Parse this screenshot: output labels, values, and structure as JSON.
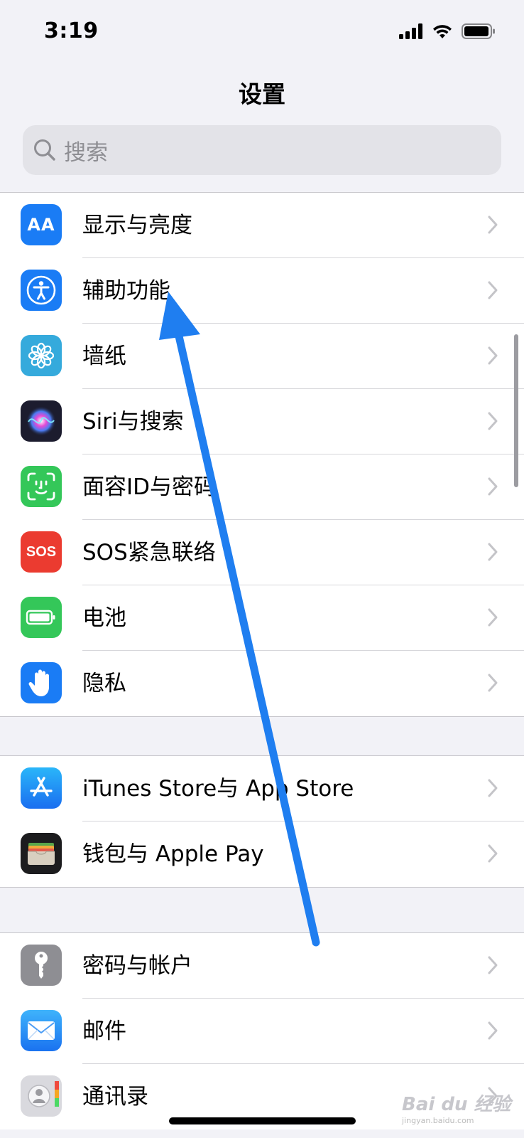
{
  "status": {
    "time": "3:19"
  },
  "nav": {
    "title": "设置"
  },
  "search": {
    "placeholder": "搜索"
  },
  "groups": [
    {
      "items": [
        {
          "label": "显示与亮度",
          "icon": "display-brightness-icon",
          "color": "#1a7cf5"
        },
        {
          "label": "辅助功能",
          "icon": "accessibility-icon",
          "color": "#1a7cf5"
        },
        {
          "label": "墙纸",
          "icon": "wallpaper-flower-icon",
          "color": "#35aadc"
        },
        {
          "label": "Siri与搜索",
          "icon": "siri-icon",
          "color": "#1c1c2e"
        },
        {
          "label": "面容ID与密码",
          "icon": "face-id-icon",
          "color": "#34c759"
        },
        {
          "label": "SOS紧急联络",
          "icon": "sos-icon",
          "color": "#eb3b30"
        },
        {
          "label": "电池",
          "icon": "battery-icon",
          "color": "#34c759"
        },
        {
          "label": "隐私",
          "icon": "privacy-hand-icon",
          "color": "#1a7cf5"
        }
      ]
    },
    {
      "items": [
        {
          "label": "iTunes Store与 App Store",
          "icon": "app-store-icon",
          "color": "#1a8cf5"
        },
        {
          "label": "钱包与 Apple Pay",
          "icon": "wallet-icon",
          "color": "#1c1c1e"
        }
      ]
    },
    {
      "items": [
        {
          "label": "密码与帐户",
          "icon": "key-icon",
          "color": "#8e8e93"
        },
        {
          "label": "邮件",
          "icon": "mail-icon",
          "color": "#2a8cf8"
        },
        {
          "label": "通讯录",
          "icon": "contacts-icon",
          "color": "#d9d9de"
        }
      ]
    }
  ],
  "icon_text": {
    "aa": "AA",
    "sos": "SOS"
  },
  "watermark": {
    "brand": "Bai du 经验",
    "url": "jingyan.baidu.com"
  }
}
